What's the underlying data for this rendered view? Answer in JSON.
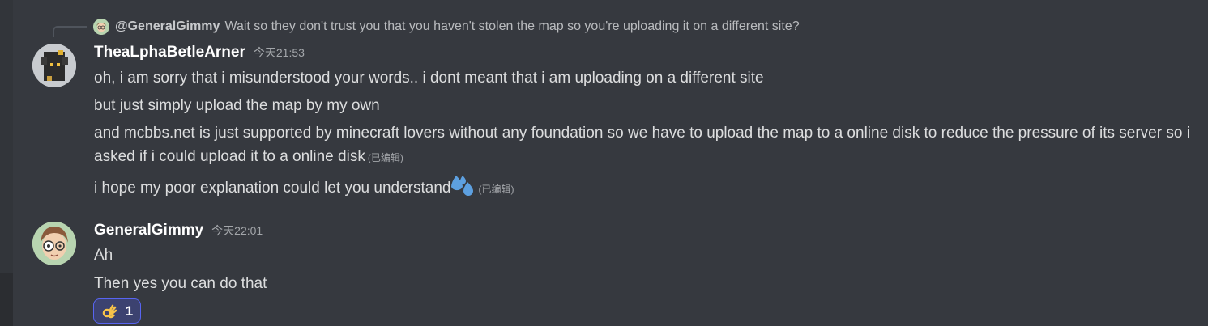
{
  "reply": {
    "author": "@GeneralGimmy",
    "text": "Wait so they don't trust you that you haven't stolen the map so you're uploading it on a different site?"
  },
  "messages": [
    {
      "username": "TheaLphaBetleArner",
      "timestamp": "今天21:53",
      "lines": [
        {
          "text": "oh, i am sorry that i misunderstood your words.. i dont meant that i am uploading on a different site"
        },
        {
          "text": "but just simply upload the map by my own"
        },
        {
          "text": "and mcbbs.net is just supported by minecraft lovers without any foundation so we have to upload the map to a online disk to reduce the pressure of its server so i asked if i could upload it to a online disk",
          "edited": "(已编辑)"
        },
        {
          "text": "i hope my poor explanation could let you understand",
          "emoji": "sweat-drops",
          "edited": "(已编辑)"
        }
      ]
    },
    {
      "username": "GeneralGimmy",
      "timestamp": "今天22:01",
      "lines": [
        {
          "text": "Ah"
        },
        {
          "text": "Then yes you can do that"
        }
      ],
      "reaction": {
        "emoji": "ok-hand",
        "count": "1"
      }
    }
  ],
  "colors": {
    "background": "#36393f",
    "username": "#ffffff",
    "text": "#dcddde",
    "muted": "#a3a6aa",
    "reaction_border": "#5865f2"
  }
}
